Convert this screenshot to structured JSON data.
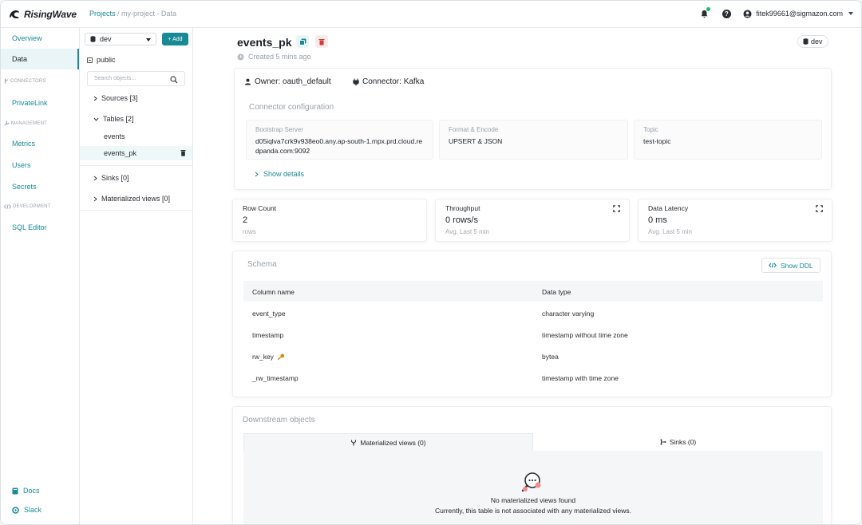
{
  "app": {
    "name": "RisingWave"
  },
  "breadcrumb": {
    "projects": "Projects",
    "rest": " / my-project - Data"
  },
  "user": {
    "email": "fitek99661@sigmazon.com"
  },
  "colors": {
    "accent": "#178a95",
    "danger": "#d23b3b"
  },
  "nav": {
    "overview": "Overview",
    "data": "Data",
    "connectors_section": "CONNECTORS",
    "privatelink": "PrivateLink",
    "management_section": "MANAGEMENT",
    "metrics": "Metrics",
    "users": "Users",
    "secrets": "Secrets",
    "development_section": "DEVELOPMENT",
    "sql_editor": "SQL Editor",
    "docs": "Docs",
    "slack": "Slack"
  },
  "tree": {
    "database": "dev",
    "add_label": "+ Add",
    "schema": "public",
    "search_placeholder": "Search objects...",
    "sources": "Sources [3]",
    "tables": "Tables [2]",
    "table_items": [
      "events",
      "events_pk"
    ],
    "sinks": "Sinks [0]",
    "materialized_views": "Materialized views [0]"
  },
  "detail": {
    "title": "events_pk",
    "created": "Created 5 mins ago",
    "database_badge": "dev",
    "owner": "Owner: oauth_default",
    "connector": "Connector: Kafka",
    "connector_config_title": "Connector configuration",
    "config": [
      {
        "label": "Bootstrap Server",
        "value": "d05iqlva7crk9v938eo0.any.ap-south-1.mpx.prd.cloud.redpanda.com:9092"
      },
      {
        "label": "Format & Encode",
        "value": "UPSERT & JSON"
      },
      {
        "label": "Topic",
        "value": "test-topic"
      }
    ],
    "show_details": "Show details"
  },
  "metrics": [
    {
      "label": "Row Count",
      "value": "2",
      "sub": "rows"
    },
    {
      "label": "Throughput",
      "value": "0 rows/s",
      "sub": "Avg. Last 5 min"
    },
    {
      "label": "Data Latency",
      "value": "0 ms",
      "sub": "Avg. Last 5 min"
    }
  ],
  "schema": {
    "title": "Schema",
    "show_ddl": "Show DDL",
    "headers": [
      "Column name",
      "Data type"
    ],
    "rows": [
      {
        "name": "event_type",
        "type": "character varying"
      },
      {
        "name": "timestamp",
        "type": "timestamp without time zone"
      },
      {
        "name": "rw_key",
        "type": "bytea"
      },
      {
        "name": "_rw_timestamp",
        "type": "timestamp with time zone"
      }
    ]
  },
  "downstream": {
    "title": "Downstream objects",
    "tab_mv": "Materialized views (0)",
    "tab_sinks": "Sinks (0)",
    "empty_title": "No materialized views found",
    "empty_sub": "Currently, this table is not associated with any materialized views."
  }
}
